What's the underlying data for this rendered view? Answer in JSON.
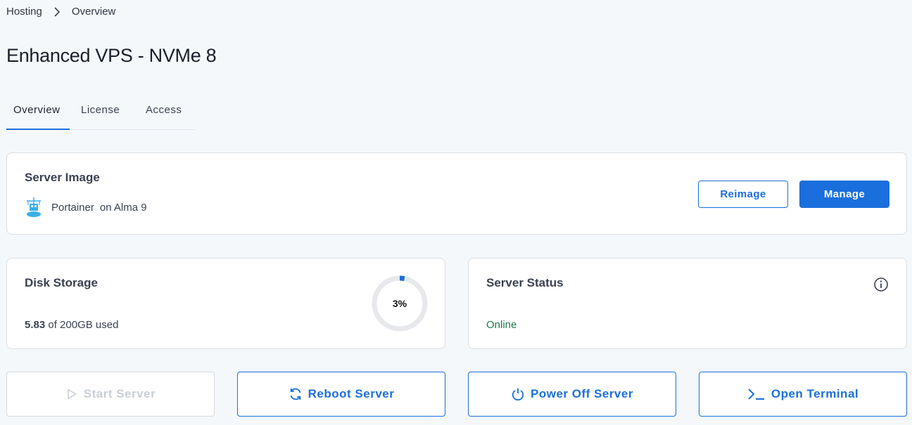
{
  "breadcrumb": {
    "items": [
      "Hosting",
      "Overview"
    ]
  },
  "page": {
    "title": "Enhanced VPS - NVMe 8"
  },
  "tabs": [
    {
      "label": "Overview",
      "active": true
    },
    {
      "label": "License",
      "active": false
    },
    {
      "label": "Access",
      "active": false
    }
  ],
  "server_image": {
    "title": "Server Image",
    "app_name": "Portainer",
    "os": "on Alma 9",
    "icon": "portainer-icon",
    "reimage_label": "Reimage",
    "manage_label": "Manage"
  },
  "disk": {
    "title": "Disk Storage",
    "used_value": "5.83",
    "used_suffix": " of 200GB used",
    "percent_label": "3%",
    "percent": 3
  },
  "status": {
    "title": "Server Status",
    "value": "Online",
    "info_icon": "info-icon"
  },
  "actions": {
    "start": "Start Server",
    "reboot": "Reboot Server",
    "power_off": "Power Off Server",
    "terminal": "Open Terminal"
  },
  "colors": {
    "accent": "#1b6fdc",
    "online": "#1a7a4a",
    "disabled": "#c9ced6",
    "background": "#f5f8fb"
  }
}
